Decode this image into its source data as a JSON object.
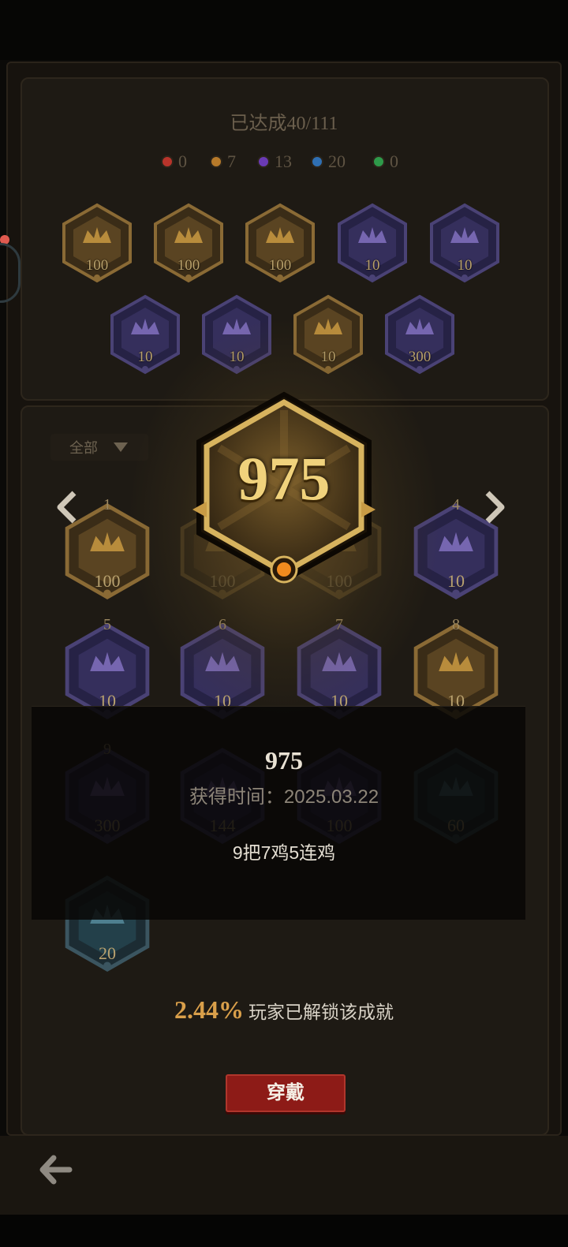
{
  "summary": {
    "progress": "已达成40/111"
  },
  "rarity_counts": [
    {
      "color": "#b8342b",
      "count": "0"
    },
    {
      "color": "#b77a2a",
      "count": "7"
    },
    {
      "color": "#6a3ab4",
      "count": "13"
    },
    {
      "color": "#2f6fb3",
      "count": "20"
    },
    {
      "color": "#2e9a4a",
      "count": "0"
    }
  ],
  "equipped_badges": [
    {
      "value": "100",
      "tier": "gold",
      "icon": "crown-icon"
    },
    {
      "value": "100",
      "tier": "gold",
      "icon": "wreath-icon"
    },
    {
      "value": "100",
      "tier": "gold",
      "icon": "crown-icon"
    },
    {
      "value": "10",
      "tier": "purple",
      "icon": "sword-icon"
    },
    {
      "value": "10",
      "tier": "purple",
      "icon": "crown-icon"
    },
    {
      "value": "10",
      "tier": "purple",
      "icon": "rose-icon"
    },
    {
      "value": "10",
      "tier": "purple",
      "icon": "fist-icon"
    },
    {
      "value": "10",
      "tier": "gold",
      "icon": "trophy-icon"
    },
    {
      "value": "300",
      "tier": "purple",
      "icon": "mask-icon"
    }
  ],
  "filter": {
    "label": "全部"
  },
  "grid_badges": [
    {
      "index": "1",
      "value": "100",
      "tier": "gold"
    },
    {
      "index": "",
      "value": "100",
      "tier": "gold"
    },
    {
      "index": "",
      "value": "100",
      "tier": "gold"
    },
    {
      "index": "4",
      "value": "10",
      "tier": "purple"
    },
    {
      "index": "5",
      "value": "10",
      "tier": "purple"
    },
    {
      "index": "6",
      "value": "10",
      "tier": "purple"
    },
    {
      "index": "7",
      "value": "10",
      "tier": "purple"
    },
    {
      "index": "8",
      "value": "10",
      "tier": "gold"
    },
    {
      "index": "9",
      "value": "300",
      "tier": "purple"
    },
    {
      "index": "",
      "value": "144",
      "tier": "purple"
    },
    {
      "index": "",
      "value": "100",
      "tier": "purple"
    },
    {
      "index": "",
      "value": "60",
      "tier": "blue"
    },
    {
      "index": "",
      "value": "20",
      "tier": "blue"
    }
  ],
  "selected": {
    "value": "975",
    "title": "975",
    "obtained": "获得时间：2025.03.22",
    "description": "9把7鸡5连鸡",
    "unlock_percent": "2.44%",
    "unlock_text": "玩家已解锁该成就",
    "wear_label": "穿戴"
  },
  "colors": {
    "gold": "#c9a24c",
    "purple": "#5a4a9a",
    "blue": "#3e6f8a",
    "accent_red": "#8d1b17"
  }
}
